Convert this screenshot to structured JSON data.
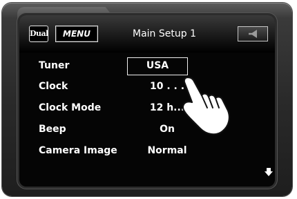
{
  "brand": "Dual",
  "header": {
    "menu_label": "MENU",
    "title": "Main Setup 1",
    "corner_icon": "speaker-icon"
  },
  "settings": [
    {
      "label": "Tuner",
      "value": "USA"
    },
    {
      "label": "Clock",
      "value": "10 . . ."
    },
    {
      "label": "Clock Mode",
      "value": "12 h..."
    },
    {
      "label": "Beep",
      "value": "On"
    },
    {
      "label": "Camera Image",
      "value": "Normal"
    }
  ],
  "icons": {
    "scroll": "down-arrow-icon",
    "pointer": "hand-pointer-icon"
  }
}
